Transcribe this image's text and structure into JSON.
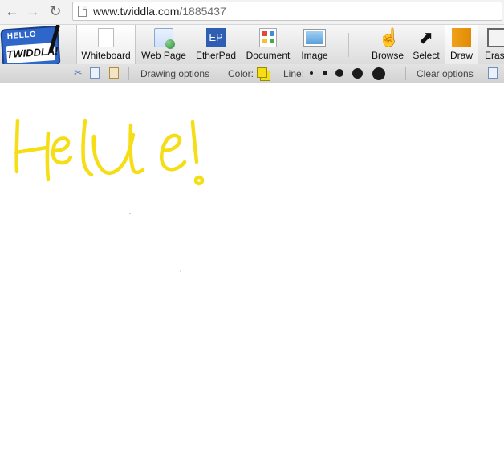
{
  "browser": {
    "url_domain": "www.twiddla.com",
    "url_path": "/1885437",
    "back_icon": "back-arrow-icon",
    "forward_icon": "forward-arrow-icon",
    "reload_icon": "reload-icon"
  },
  "logo": {
    "hello": "HELLO",
    "name": "TWIDDLA!"
  },
  "toolbar": {
    "tools": [
      {
        "label": "Whiteboard",
        "icon": "whiteboard-icon",
        "active": true
      },
      {
        "label": "Web Page",
        "icon": "web-page-icon"
      },
      {
        "label": "EtherPad",
        "icon": "etherpad-icon",
        "icon_text": "EP"
      },
      {
        "label": "Document",
        "icon": "document-icon"
      },
      {
        "label": "Image",
        "icon": "image-icon"
      },
      {
        "label": "Browse",
        "icon": "hand-icon"
      },
      {
        "label": "Select",
        "icon": "arrow-cursor-icon"
      },
      {
        "label": "Draw",
        "icon": "pencil-icon",
        "active": true
      },
      {
        "label": "Erase",
        "icon": "eraser-icon"
      }
    ]
  },
  "options": {
    "drawing_options": "Drawing options",
    "color_label": "Color:",
    "color_value": "#f5de16",
    "line_label": "Line:",
    "line_sizes": [
      1,
      2,
      3,
      4,
      5
    ],
    "clear_options": "Clear options"
  },
  "canvas": {
    "ink_color": "#f5de16"
  }
}
